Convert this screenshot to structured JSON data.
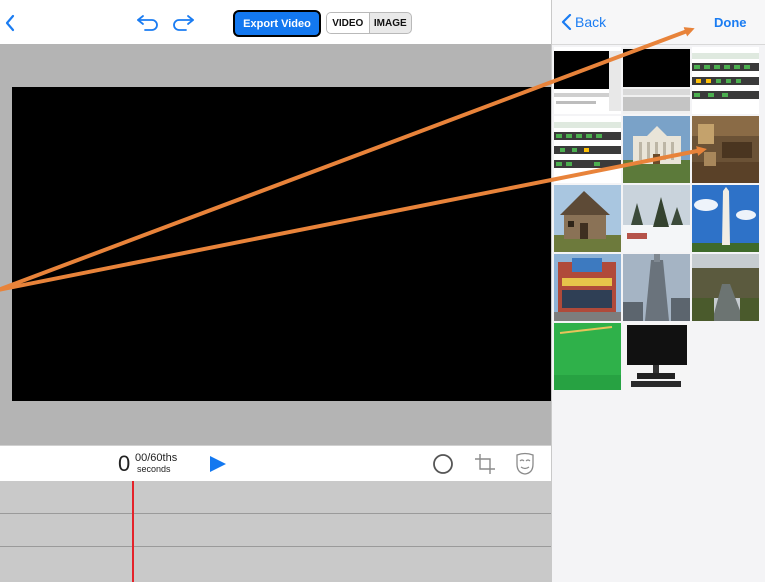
{
  "toolbar": {
    "back_icon": "chevron-left-icon",
    "undo_icon": "undo-icon",
    "redo_icon": "redo-icon",
    "export_label": "Export Video",
    "mode_options": [
      "VIDEO",
      "IMAGE"
    ],
    "mode_selected": "VIDEO"
  },
  "playback": {
    "time_seconds": "0",
    "time_fraction": "00/60ths",
    "time_unit": "seconds",
    "play_icon": "play-icon",
    "tools": [
      "circle-icon",
      "crop-icon",
      "mask-icon"
    ]
  },
  "picker": {
    "back_label": "Back",
    "done_label": "Done",
    "thumbnails": [
      "screenshot-thumbnail",
      "screenshot-thumbnail",
      "screenshot-thumbnail",
      "screenshot-thumbnail",
      "white-house-photo",
      "interior-room-photo",
      "wooden-house-photo",
      "snowy-forest-photo",
      "monument-photo",
      "storefront-photo",
      "skyscraper-photo",
      "river-photo",
      "green-screen-photo",
      "computer-monitor-photo"
    ]
  },
  "colors": {
    "accent": "#1378f0",
    "link": "#1a7cf2",
    "playhead": "#e4222a",
    "annotation_arrow": "#e8833a"
  }
}
